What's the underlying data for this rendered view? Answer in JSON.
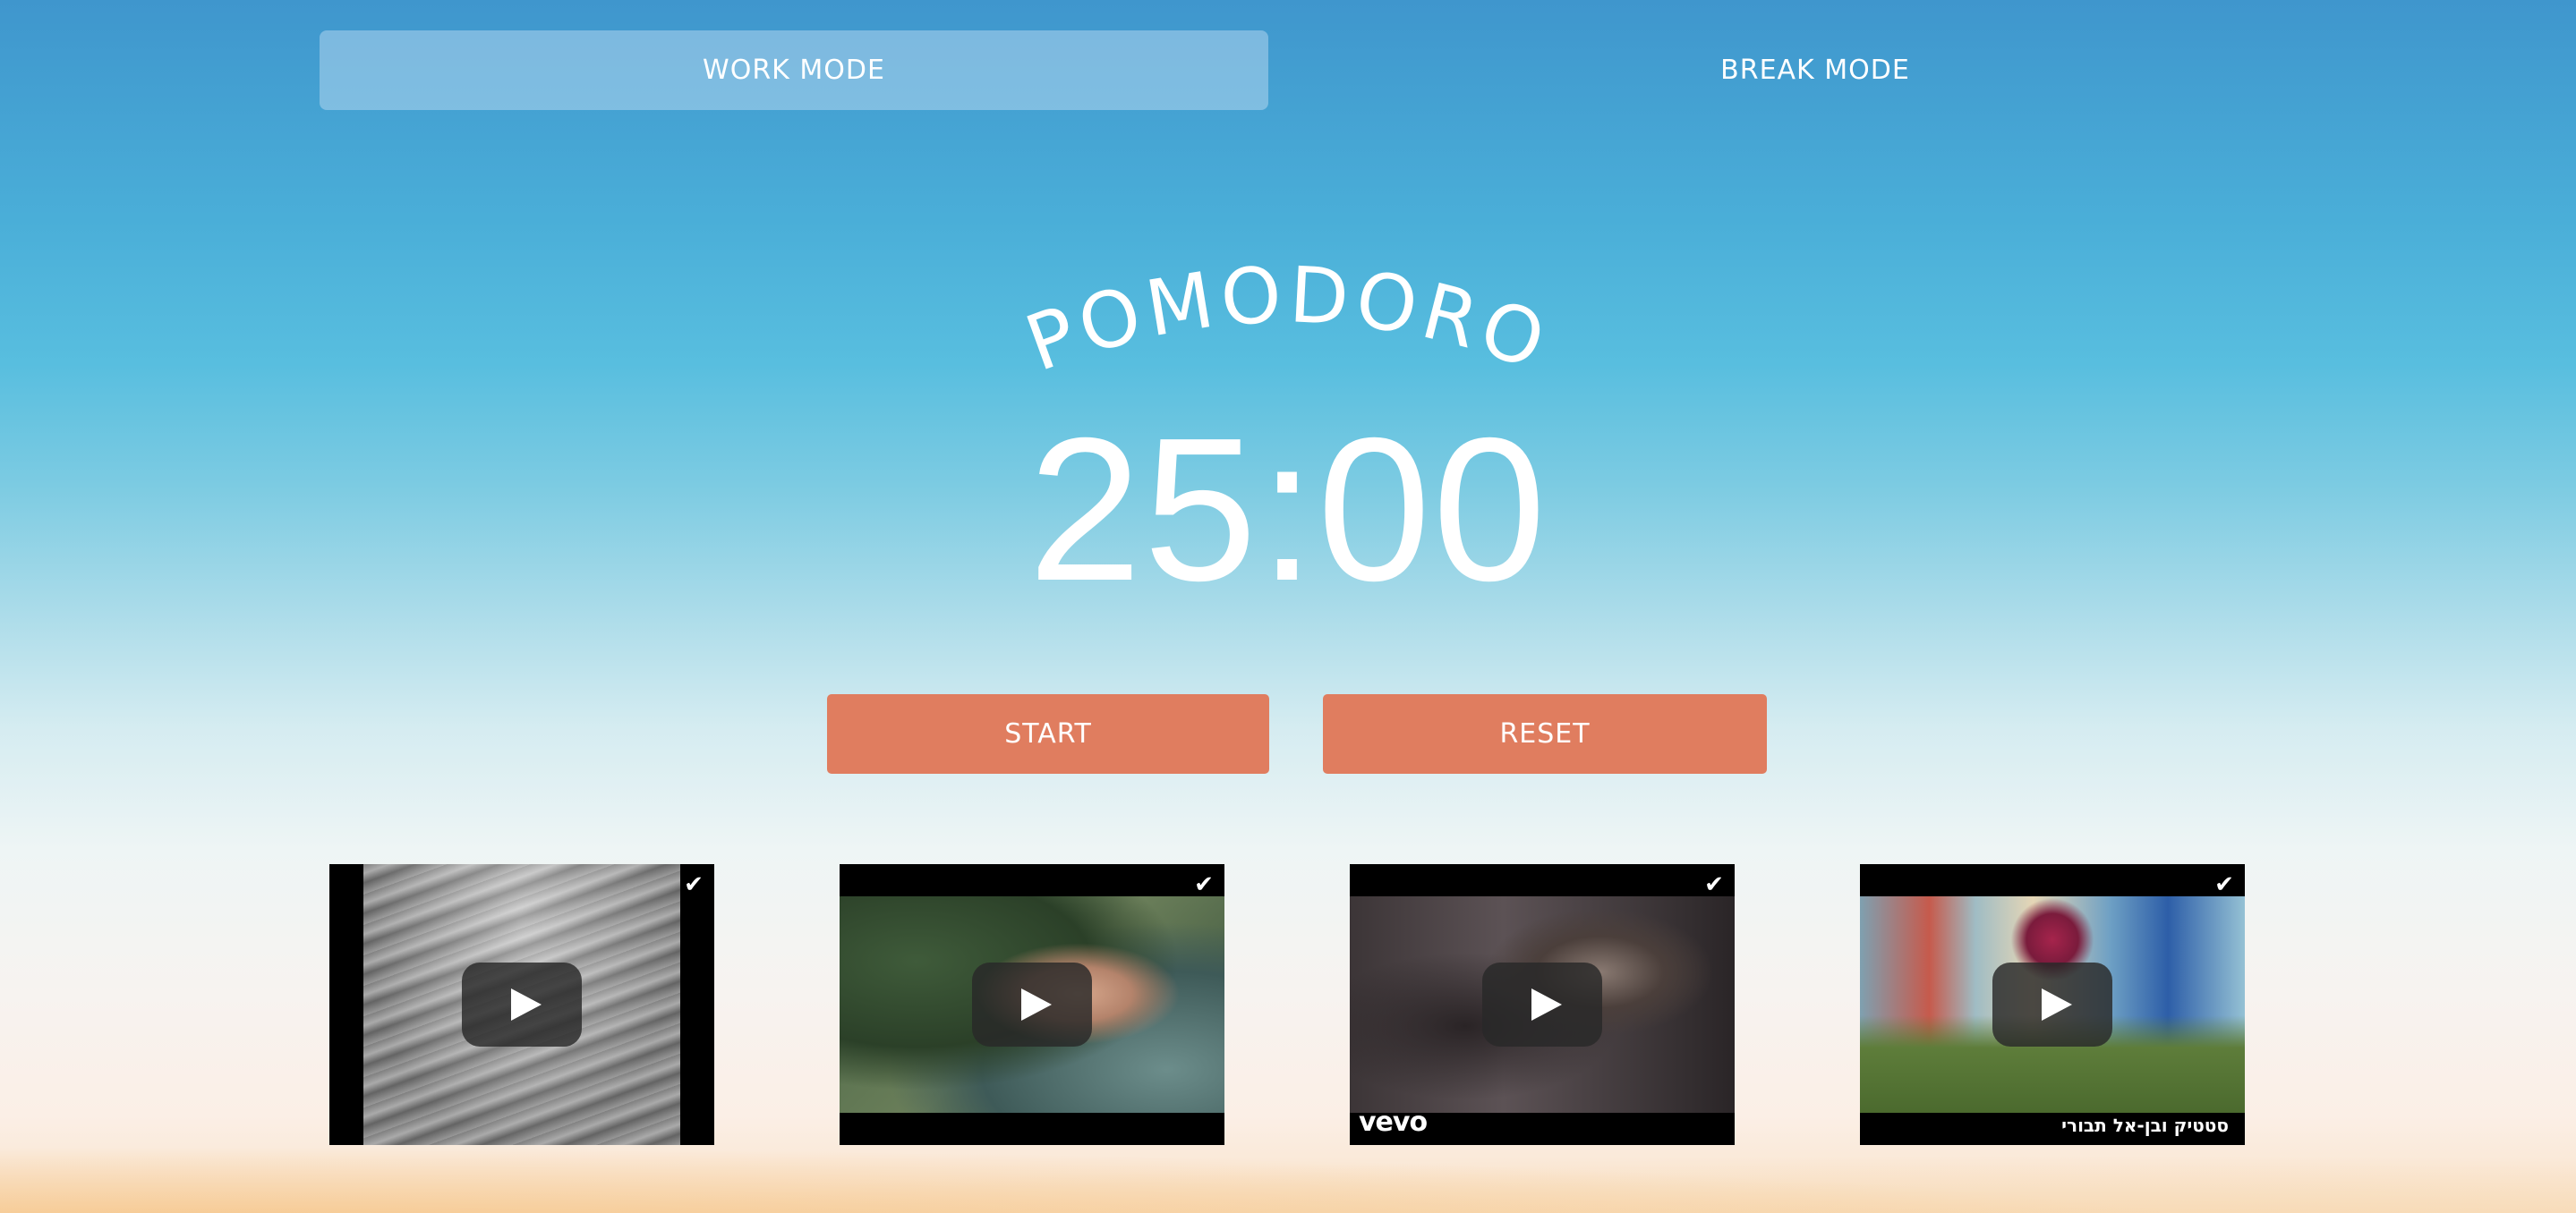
{
  "modes": {
    "work_label": "WORK MODE",
    "break_label": "BREAK MODE",
    "active": "work"
  },
  "title": "POMODORO",
  "timer": "25:00",
  "buttons": {
    "start_label": "START",
    "reset_label": "RESET"
  },
  "colors": {
    "button": "#e07d5f",
    "text": "#ffffff",
    "active_tab": "rgba(200,225,245,0.45)"
  },
  "videos": [
    {
      "selected": true
    },
    {
      "selected": true
    },
    {
      "selected": true,
      "logo": "vevo"
    },
    {
      "selected": true,
      "caption": "סטטיק ובן-אל תבורי"
    }
  ],
  "icons": {
    "check": "✔"
  }
}
